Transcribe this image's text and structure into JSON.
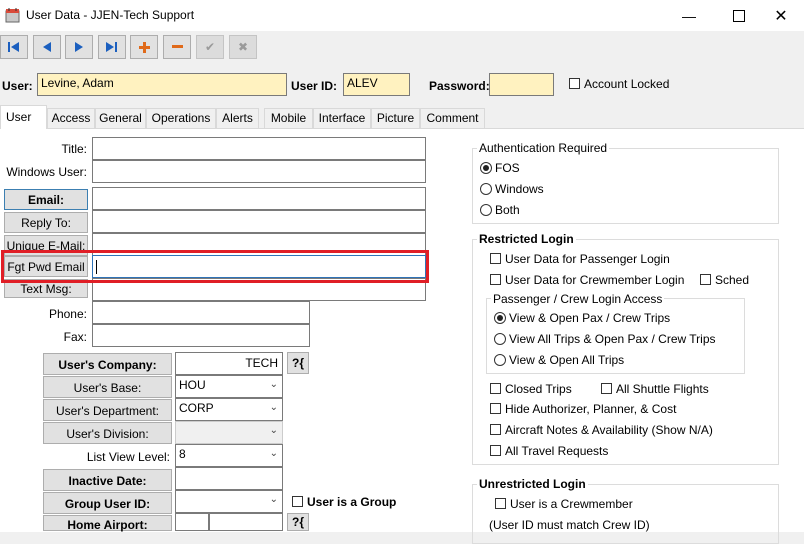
{
  "window": {
    "title": "User Data - JJEN-Tech Support",
    "minimize_icon": "minimize-icon",
    "maximize_icon": "maximize-icon",
    "close_icon": "close-icon"
  },
  "toolbar": {
    "buttons": [
      {
        "icon": "first-record-icon",
        "glyph": "|◀"
      },
      {
        "icon": "previous-record-icon",
        "glyph": "◀"
      },
      {
        "icon": "next-record-icon",
        "glyph": "▶"
      },
      {
        "icon": "last-record-icon",
        "glyph": "▶|"
      },
      {
        "icon": "add-record-icon",
        "glyph": "✚"
      },
      {
        "icon": "delete-record-icon",
        "glyph": "▬"
      },
      {
        "icon": "save-record-icon",
        "glyph": "✔"
      },
      {
        "icon": "cancel-record-icon",
        "glyph": "✖"
      }
    ]
  },
  "header": {
    "user_label": "User:",
    "user_value": "Levine, Adam",
    "userid_label": "User ID:",
    "userid_value": "ALEV",
    "password_label": "Password:",
    "password_value": "",
    "account_locked_label": "Account Locked"
  },
  "tabs": [
    "User",
    "Access",
    "General",
    "Operations",
    "Alerts",
    "Mobile",
    "Interface",
    "Picture",
    "Comment"
  ],
  "form": {
    "title_label": "Title:",
    "title_value": "",
    "windows_user_label": "Windows User:",
    "windows_user_value": "",
    "email_label": "Email:",
    "email_value": "",
    "reply_to_label": "Reply To:",
    "reply_to_value": "",
    "unique_email_label": "Unique E-Mail:",
    "unique_email_value": "",
    "fgt_pwd_email_label": "Fgt Pwd Email",
    "fgt_pwd_email_value": "",
    "text_msg_label": "Text Msg:",
    "text_msg_value": "",
    "phone_label": "Phone:",
    "phone_value": "",
    "fax_label": "Fax:",
    "fax_value": "",
    "company_label": "User's Company:",
    "company_value": "TECH",
    "base_label": "User's Base:",
    "base_value": "HOU",
    "department_label": "User's Department:",
    "department_value": "CORP",
    "division_label": "User's Division:",
    "division_value": "",
    "list_view_label": "List View Level:",
    "list_view_value": "8",
    "inactive_date_label": "Inactive Date:",
    "inactive_date_value": "",
    "group_user_id_label": "Group User ID:",
    "group_user_id_value": "",
    "user_is_group_label": "User is a Group",
    "home_airport_label": "Home Airport:",
    "home_airport_value": "",
    "lookup_glyph": "?{"
  },
  "auth": {
    "title": "Authentication Required",
    "options": [
      "FOS",
      "Windows",
      "Both"
    ],
    "selected": "FOS"
  },
  "restricted": {
    "title": "Restricted Login",
    "passenger_login": "User Data for Passenger Login",
    "crew_login": "User Data for Crewmember Login",
    "sched": "Sched",
    "access_title": "Passenger / Crew Login Access",
    "access_options": [
      "View & Open Pax / Crew Trips",
      "View All Trips & Open Pax / Crew Trips",
      "View & Open All Trips"
    ],
    "access_selected": "View & Open Pax / Crew Trips",
    "closed_trips": "Closed Trips",
    "all_shuttle": "All Shuttle Flights",
    "hide_authorizer": "Hide Authorizer, Planner, & Cost",
    "aircraft_notes": "Aircraft Notes & Availability (Show N/A)",
    "travel_requests": "All Travel Requests"
  },
  "unrestricted": {
    "title": "Unrestricted Login",
    "is_crewmember": "User is a Crewmember",
    "note": "(User ID must match Crew ID)"
  },
  "colors": {
    "highlight": "#e01e26",
    "required_field": "#fff2c0"
  }
}
